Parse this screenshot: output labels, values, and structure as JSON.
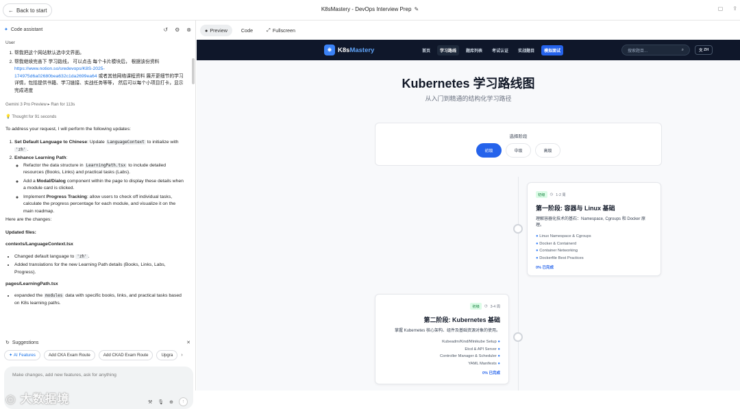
{
  "topbar": {
    "back_label": "Back to start",
    "title": "K8sMastery - DevOps Interview Prep"
  },
  "left_panel": {
    "header_label": "Code assistant",
    "user_label": "User",
    "user_request": [
      "帮我把这个网站默认选中文界面。",
      "帮我继续完善下 学习路线， 可以点击 每个卡片模块后， 根据该份资料",
      "https://www.notion.so/sredevops/K8S-2025-174975d6a02680bea632c1da2699ea64",
      "或者其他网络课程资料 展开更细节的学习详情，包括提供书籍、学习链接、实战任务等等， 然后可以每个小项目打卡，显示完成进度"
    ],
    "model_meta": "Gemini 3 Pro Preview ▸ Ran for 113s",
    "thought": "Thought for 91 seconds",
    "intro": "To address your request, I will perform the following updates:",
    "step1_bold": "Set Default Language to Chinese",
    "step1_text_a": ": Update ",
    "step1_code": "LanguageContext",
    "step1_text_b": " to initialize with ",
    "step1_code2": "'zh'",
    "step1_text_c": ".",
    "step2_bold": "Enhance Learning Path",
    "step2_colon": ":",
    "sub1_a": "Refactor the data structure in ",
    "sub1_code": "LearningPath.tsx",
    "sub1_b": " to include detailed resources (Books, Links) and practical tasks (Labs).",
    "sub2_a": "Add a ",
    "sub2_bold": "Modal/Dialog",
    "sub2_b": " component within the page to display these details when a module card is clicked.",
    "sub3_a": "Implement ",
    "sub3_bold": "Progress Tracking",
    "sub3_b": ": allow users to check off individual tasks, calculate the progress percentage for each module, and visualize it on the main roadmap.",
    "changes": "Here are the changes:",
    "updated_files": "Updated files:",
    "file1": "contexts/LanguageContext.tsx",
    "file1_b1_a": "Changed default language to ",
    "file1_b1_code": "'zh'",
    "file1_b1_c": ".",
    "file1_b2": "Added translations for the new Learning Path details (Books, Links, Labs, Progress).",
    "file2": "pages/LearningPath.tsx",
    "file2_b1_a": "expanded the ",
    "file2_b1_code": "modules",
    "file2_b1_b": " data with specific books, links, and practical tasks based on K8s learning paths.",
    "suggestions_label": "Suggestions",
    "chips": [
      "AI Features",
      "Add CKA Exam Route",
      "Add CKAD Exam Route",
      "Upgra"
    ],
    "input_placeholder": "Make changes, add new features, ask for anything",
    "watermark": "大数据境"
  },
  "right_tabs": {
    "preview": "Preview",
    "code": "Code",
    "fullscreen": "Fullscreen"
  },
  "app": {
    "logo_a": "K8s",
    "logo_b": "Mastery",
    "nav": [
      "首页",
      "学习路线",
      "题库列表",
      "考试认证",
      "实战题目",
      "模拟面试"
    ],
    "search_placeholder": "搜索题目...",
    "lang": "ZH",
    "title": "Kubernetes 学习路线图",
    "subtitle": "从入门到精通的结构化学习路径",
    "stage_label": "选择阶段",
    "stages": [
      "初级",
      "中级",
      "高级"
    ],
    "modules": [
      {
        "badge": "初级",
        "duration": "1-2 周",
        "title": "第一阶段: 容器与 Linux 基础",
        "desc": "理解容器化技术的基石：Namespace, Cgroups 和 Docker 原理。",
        "items": [
          "Linux Namespace & Cgroups",
          "Docker & Containerd",
          "Container Networking",
          "Dockerfile Best Practices"
        ],
        "progress": "0% 已完成"
      },
      {
        "badge": "初级",
        "duration": "3-4 周",
        "title": "第二阶段: Kubernetes 基础",
        "desc": "掌握 Kubernetes 核心架构、组件及基础资源对象的使用。",
        "items": [
          "Kubeadm/Kind/Minikube Setup",
          "Etcd & API Server",
          "Controller Manager & Scheduler",
          "YAML Manifests"
        ],
        "progress": "0% 已完成"
      }
    ]
  }
}
